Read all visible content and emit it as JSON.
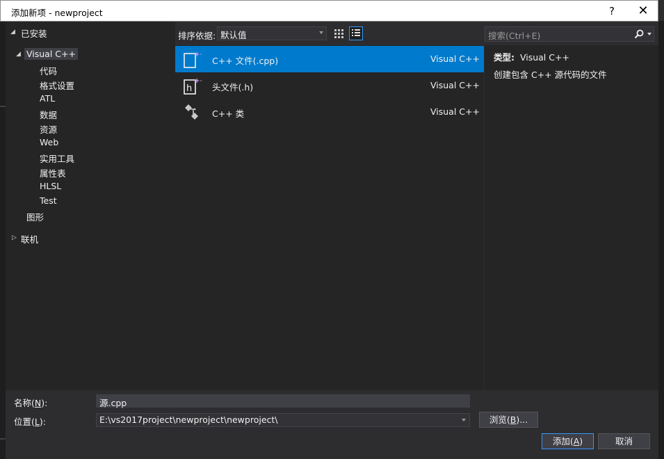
{
  "window": {
    "title": "添加新项 - newproject",
    "help_glyph": "?",
    "close_glyph": "✕"
  },
  "tree": {
    "installed_label": "已安装",
    "visual_cpp_label": "Visual C++",
    "children": [
      "代码",
      "格式设置",
      "ATL",
      "数据",
      "资源",
      "Web",
      "实用工具",
      "属性表",
      "HLSL",
      "Test"
    ],
    "graphics_label": "图形",
    "online_label": "联机"
  },
  "toolbar": {
    "sort_label": "排序依据:",
    "sort_value": "默认值"
  },
  "search": {
    "placeholder": "搜索(Ctrl+E)"
  },
  "templates": [
    {
      "name": "C++ 文件(.cpp)",
      "type": "Visual C++",
      "icon": "cpp-file-icon"
    },
    {
      "name": "头文件(.h)",
      "type": "Visual C++",
      "icon": "header-file-icon"
    },
    {
      "name": "C++ 类",
      "type": "Visual C++",
      "icon": "class-icon"
    }
  ],
  "description": {
    "type_label": "类型:",
    "type_value": "Visual C++",
    "text": "创建包含 C++ 源代码的文件"
  },
  "form": {
    "name_label_prefix": "名称(",
    "name_label_key": "N",
    "name_label_suffix": "):",
    "name_value": "源.cpp",
    "location_label_prefix": "位置(",
    "location_label_key": "L",
    "location_label_suffix": "):",
    "location_value": "E:\\vs2017project\\newproject\\newproject\\",
    "browse_prefix": "浏览(",
    "browse_key": "B",
    "browse_suffix": ")...",
    "add_prefix": "添加(",
    "add_key": "A",
    "add_suffix": ")",
    "cancel_label": "取消"
  },
  "colors": {
    "selection": "#007acc",
    "accent": "#3399ff",
    "panel": "#252526",
    "dialog": "#2d2d30"
  }
}
